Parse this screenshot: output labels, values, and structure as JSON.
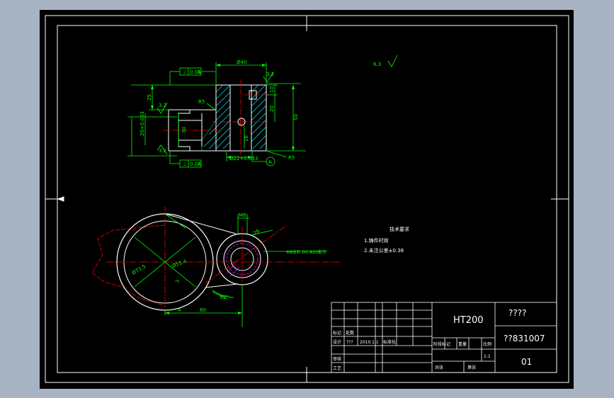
{
  "drawing": {
    "top_view": {
      "flatness_top": "0.05",
      "flatness_top_datum": "A",
      "flatness_bottom": "0.07",
      "flatness_bottom_datum": "A",
      "dim_width": "Ø40",
      "dim_25": "25",
      "dim_bore": "20+0.033",
      "dim_30": "30",
      "dim_r5_left": "R5",
      "dim_r5_right": "R5",
      "dim_10": "10",
      "dim_20": "20",
      "dim_50": "50",
      "dim_16": "16",
      "dim_hole": "Ø22+0.033",
      "rough_1": "3.2",
      "rough_2": "3.2",
      "rough_3": "3.2",
      "datum_label": "A"
    },
    "rough_note": "6.3",
    "front_view": {
      "dim_m8": "M8",
      "dim_16": "16",
      "dim_73": "Ø73.5",
      "dim_55": "Ø55.4",
      "dim_4": "4",
      "dim_60": "60",
      "dim_angle": "55°",
      "dim_26": "26",
      "dim_3": "3",
      "callout": "Φ8钻孔 DC-B25配作"
    },
    "tech_req": {
      "title": "技术要求",
      "line1": "1.铸件时效",
      "line2": "2.未注公差±0.38"
    },
    "title_block": {
      "material": "HT200",
      "name": "????",
      "code": "??831007",
      "sheet": "01",
      "scale": "1:1",
      "row_mark": "标记",
      "row_count": "处数",
      "row_design": "设计",
      "row_designer": "???",
      "row_date": "2010.1.1",
      "row_std": "标准化",
      "row_check": "审核",
      "row_craft": "工艺",
      "row_stage": "阶段标记",
      "row_weight": "重量",
      "row_ratio": "比例",
      "row_total": "共张",
      "row_page": "第张"
    }
  },
  "colors": {
    "background": "#000000",
    "outline": "#ffffff",
    "dimension": "#00ff00",
    "centerline": "#ff0000",
    "hatch": "#00ffff",
    "hidden": "#ff00ff",
    "window": "#a7b3c2"
  }
}
